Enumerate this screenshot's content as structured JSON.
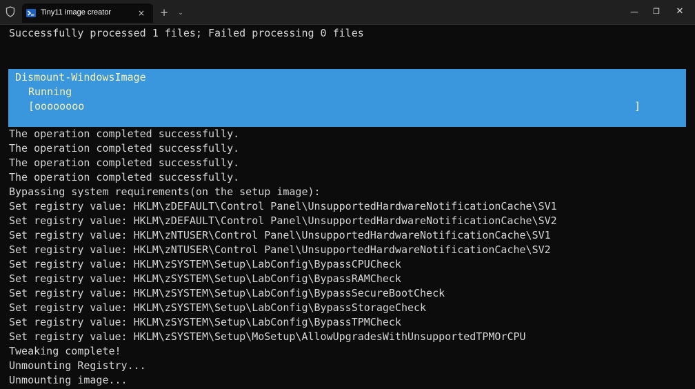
{
  "window": {
    "tab_title": "Tiny11 image creator",
    "tab_close_glyph": "×",
    "new_tab_glyph": "+",
    "dropdown_glyph": "⌄",
    "minimize_glyph": "—",
    "maximize_glyph": "❐",
    "close_glyph": "✕"
  },
  "colors": {
    "background": "#0c0c0c",
    "text": "#d6d6d6",
    "progress_background": "#3a96dd",
    "progress_text": "#f9f1a5",
    "titlebar": "#202020"
  },
  "terminal": {
    "summary": "Successfully processed 1 files; Failed processing 0 files",
    "progress": {
      "activity": "Dismount-WindowsImage",
      "status": "Running",
      "bar_start": "[oooooooo",
      "bar_end": "]"
    },
    "lines": [
      "The operation completed successfully.",
      "The operation completed successfully.",
      "The operation completed successfully.",
      "The operation completed successfully.",
      "Bypassing system requirements(on the setup image):",
      "Set registry value: HKLM\\zDEFAULT\\Control Panel\\UnsupportedHardwareNotificationCache\\SV1",
      "Set registry value: HKLM\\zDEFAULT\\Control Panel\\UnsupportedHardwareNotificationCache\\SV2",
      "Set registry value: HKLM\\zNTUSER\\Control Panel\\UnsupportedHardwareNotificationCache\\SV1",
      "Set registry value: HKLM\\zNTUSER\\Control Panel\\UnsupportedHardwareNotificationCache\\SV2",
      "Set registry value: HKLM\\zSYSTEM\\Setup\\LabConfig\\BypassCPUCheck",
      "Set registry value: HKLM\\zSYSTEM\\Setup\\LabConfig\\BypassRAMCheck",
      "Set registry value: HKLM\\zSYSTEM\\Setup\\LabConfig\\BypassSecureBootCheck",
      "Set registry value: HKLM\\zSYSTEM\\Setup\\LabConfig\\BypassStorageCheck",
      "Set registry value: HKLM\\zSYSTEM\\Setup\\LabConfig\\BypassTPMCheck",
      "Set registry value: HKLM\\zSYSTEM\\Setup\\MoSetup\\AllowUpgradesWithUnsupportedTPMOrCPU",
      "Tweaking complete!",
      "Unmounting Registry...",
      "Unmounting image..."
    ]
  }
}
